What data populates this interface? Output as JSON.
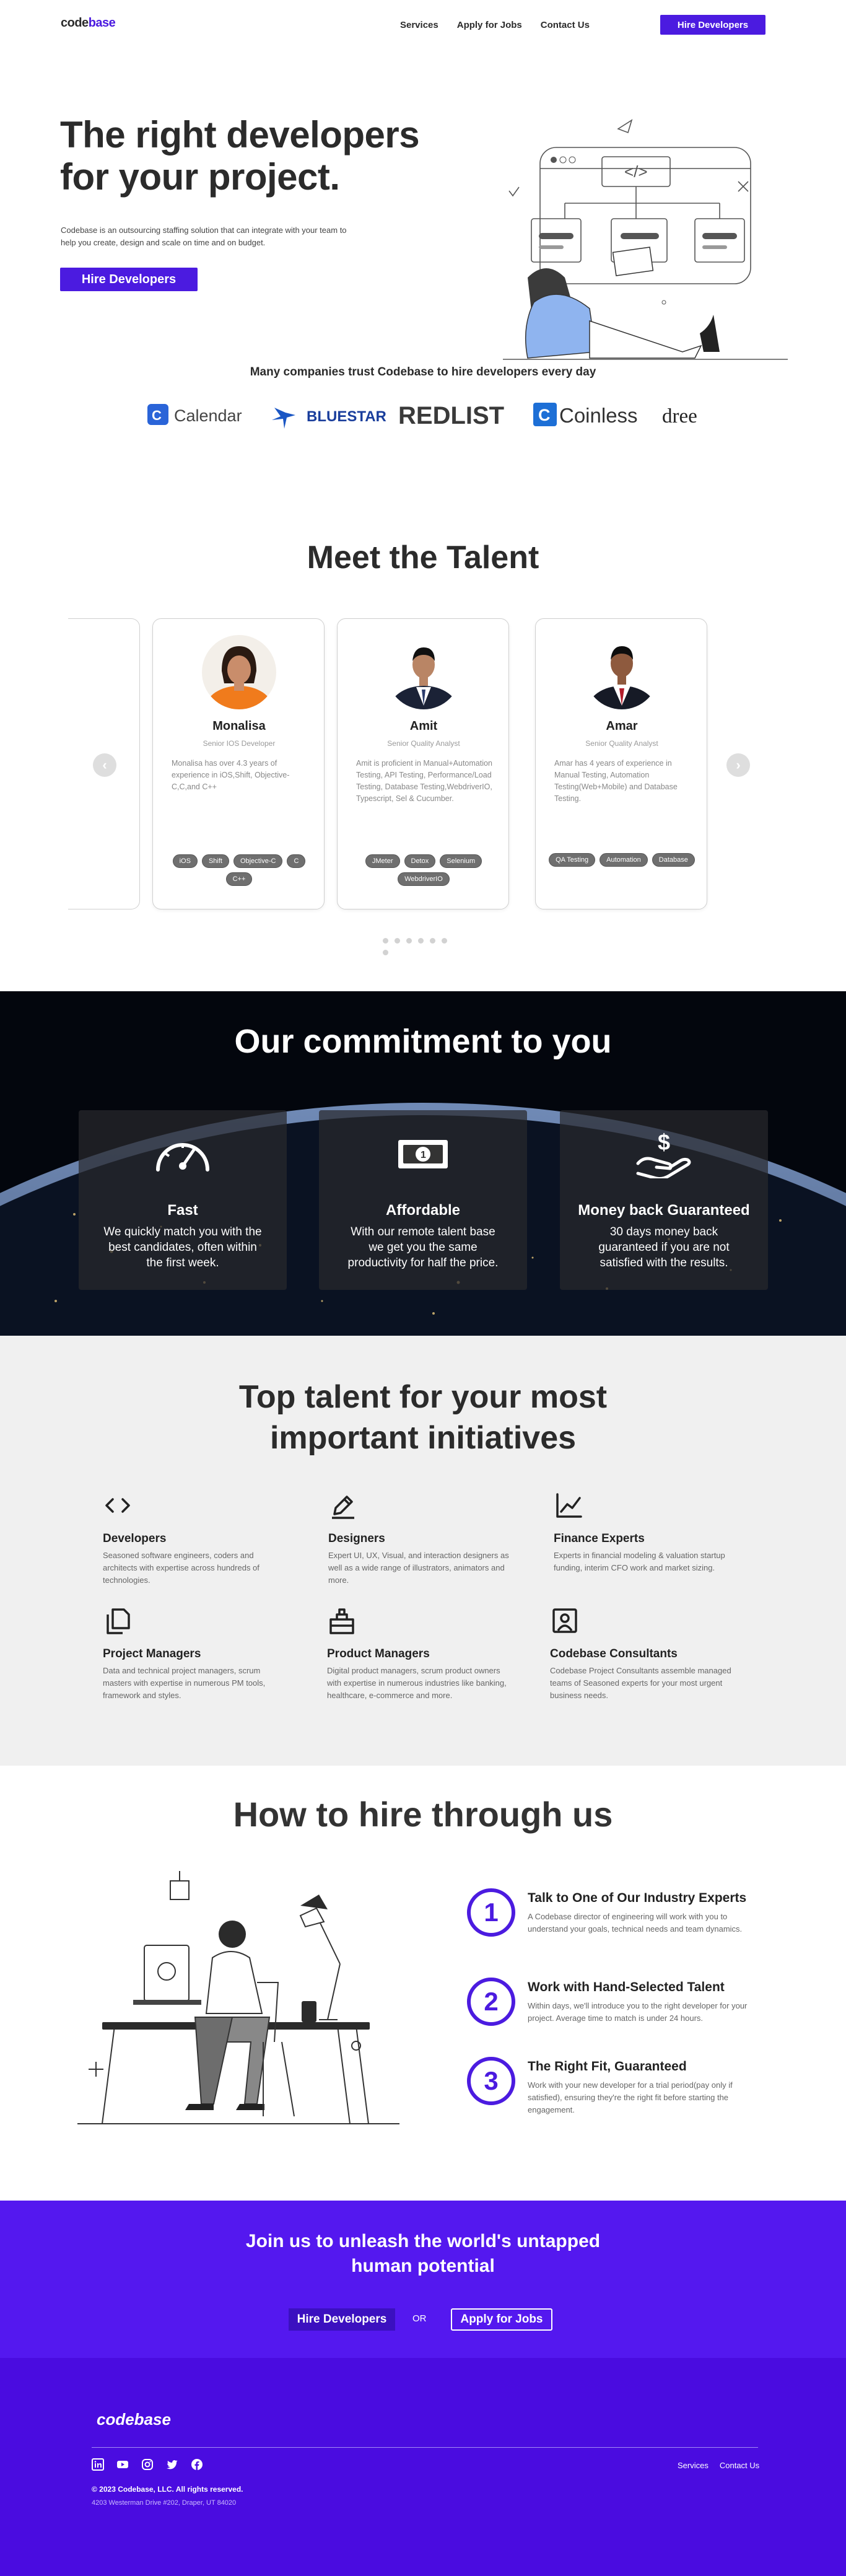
{
  "header": {
    "logo_main": "code",
    "logo_accent": "base",
    "nav": [
      "Services",
      "Apply for Jobs",
      "Contact Us"
    ],
    "cta": "Hire Developers"
  },
  "hero": {
    "title": "The right developers for your project.",
    "description": "Codebase is an outsourcing staffing solution that can integrate with your team to help you create, design and scale on time and on budget.",
    "cta": "Hire Developers"
  },
  "trust": {
    "title": "Many companies trust Codebase to hire developers every day",
    "logos": [
      "Calendar",
      "BLUESTAR",
      "REDLIST",
      "Coinless",
      "dree"
    ]
  },
  "talent": {
    "title": "Meet the Talent",
    "profiles": [
      {
        "name": "Monalisa",
        "role": "Senior IOS Developer",
        "bio": "Monalisa has over 4.3 years of experience in iOS,Shift, Objective-C,C,and C++",
        "tags": [
          "iOS",
          "Shift",
          "Objective-C",
          "C",
          "C++"
        ]
      },
      {
        "name": "Amit",
        "role": "Senior Quality Analyst",
        "bio": "Amit is proficient in Manual+Automation Testing, API Testing, Performance/Load Testing, Database Testing,WebdriverIO, Typescript, Sel & Cucumber.",
        "tags": [
          "JMeter",
          "Detox",
          "Selenium",
          "WebdriverIO"
        ]
      },
      {
        "name": "Amar",
        "role": "Senior Quality Analyst",
        "bio": "Amar has 4 years of experience in Manual Testing, Automation Testing(Web+Mobile) and Database Testing.",
        "tags": [
          "QA Testing",
          "Automation",
          "Database"
        ]
      }
    ],
    "prev_arrow": "‹",
    "next_arrow": "›"
  },
  "commitment": {
    "title": "Our commitment to you",
    "cards": [
      {
        "icon": "speedometer-icon",
        "title": "Fast",
        "text": "We quickly match you with the best candidates, often within the first week."
      },
      {
        "icon": "money-icon",
        "title": "Affordable",
        "text": "With our remote talent base we get you the same productivity for half the price."
      },
      {
        "icon": "money-hand-icon",
        "title": "Money back Guaranteed",
        "text": "30 days money back guaranteed if you are not satisfied with the results."
      }
    ]
  },
  "top_talent": {
    "title": "Top talent for your most important initiatives",
    "features": [
      {
        "icon": "code-icon",
        "title": "Developers",
        "text": "Seasoned software engineers, coders and architects with expertise across hundreds of technologies."
      },
      {
        "icon": "pen-icon",
        "title": "Designers",
        "text": "Expert UI, UX, Visual, and interaction designers as well as a wide range of illustrators, animators and more."
      },
      {
        "icon": "chart-icon",
        "title": "Finance Experts",
        "text": "Experts in financial modeling & valuation startup funding, interim CFO work and market sizing."
      },
      {
        "icon": "documents-icon",
        "title": "Project Managers",
        "text": "Data and technical project managers, scrum masters with expertise in numerous PM tools, framework and styles."
      },
      {
        "icon": "box-icon",
        "title": "Product Managers",
        "text": "Digital product managers, scrum product owners with expertise in numerous industries like banking, healthcare, e-commerce and more."
      },
      {
        "icon": "user-frame-icon",
        "title": "Codebase Consultants",
        "text": "Codebase Project Consultants assemble managed teams of Seasoned experts for your most urgent business needs."
      }
    ]
  },
  "how": {
    "title": "How to hire through us",
    "steps": [
      {
        "num": "1",
        "title": "Talk to One of Our Industry Experts",
        "text": "A Codebase director of engineering will work with you to understand your goals, technical needs and team dynamics."
      },
      {
        "num": "2",
        "title": "Work with Hand-Selected Talent",
        "text": "Within days, we'll introduce you to the right developer for your project. Average time to match is under 24 hours."
      },
      {
        "num": "3",
        "title": "The Right Fit, Guaranteed",
        "text": "Work with your new developer for a trial period(pay only if satisfied), ensuring they're the right fit before starting the engagement."
      }
    ]
  },
  "join": {
    "title": "Join us to unleash the world's untapped human potential",
    "hire": "Hire Developers",
    "or": "OR",
    "apply": "Apply for Jobs"
  },
  "footer": {
    "logo": "codebase",
    "links": [
      "Services",
      "Contact Us"
    ],
    "copyright": "© 2023 Codebase, LLC. All rights reserved.",
    "address": "4203 Westerman Drive #202, Draper, UT 84020",
    "socials": [
      "linkedin-icon",
      "youtube-icon",
      "instagram-icon",
      "twitter-icon",
      "facebook-icon"
    ]
  },
  "colors": {
    "brand": "#4b1be0",
    "join_bg": "#5418ef",
    "footer_bg": "#4a0ce0",
    "tag_bg": "#6f6f6f",
    "light_section": "#f0f0f0"
  }
}
